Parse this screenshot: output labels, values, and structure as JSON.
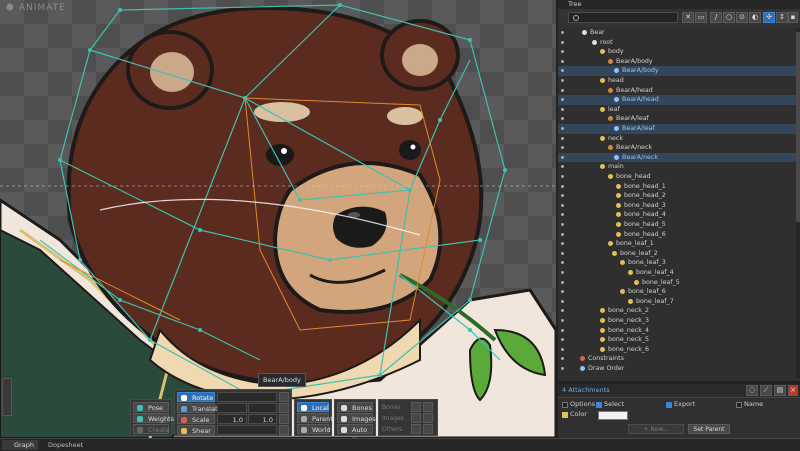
{
  "app": {
    "mode_title": "ANIMATE",
    "tooltip": "BearA/body"
  },
  "colors": {
    "accent": "#2e6fb3",
    "bone_green": "#40c0b0",
    "bone_orange": "#e08a2a",
    "panel_bg": "#2f2f2f"
  },
  "toolbar": {
    "pose": {
      "label": "Pose",
      "icon": "pose-icon"
    },
    "weights": {
      "label": "Weights",
      "icon": "weights-icon"
    },
    "create": {
      "label": "Create",
      "icon": "create-icon"
    },
    "rotate": {
      "label": "Rotate",
      "icon": "rotate-icon"
    },
    "translate": {
      "label": "Translate",
      "icon": "translate-icon"
    },
    "scale": {
      "label": "Scale",
      "x": "1.0",
      "y": "1.0",
      "icon": "scale-icon"
    },
    "shear": {
      "label": "Shear",
      "icon": "shear-icon"
    },
    "local": "Local",
    "parent": "Parent",
    "world": "World",
    "bones": "Bones",
    "images": "Images",
    "auto_key": "Auto Key",
    "sub_bones": "Bones",
    "sub_images": "Images",
    "sub_others": "Others"
  },
  "bottom_tabs": [
    {
      "label": "Graph"
    },
    {
      "label": "Dopesheet"
    }
  ],
  "tree_panel": {
    "title": "Tree",
    "rows": [
      {
        "label": "Bear",
        "icon": "skeleton-icon",
        "color": "#d0d0d0"
      },
      {
        "label": "root",
        "icon": "root-bone-icon",
        "color": "#d0d0d0"
      },
      {
        "label": "body",
        "icon": "bone-icon",
        "color": "#d0d0d0"
      },
      {
        "label": "BearA/body",
        "icon": "slot-icon",
        "color": "#d0d0d0"
      },
      {
        "label": "BearA/body",
        "icon": "image-icon",
        "color": "#8fc3ff"
      },
      {
        "label": "head",
        "icon": "bone-icon",
        "color": "#d0d0d0"
      },
      {
        "label": "BearA/head",
        "icon": "slot-icon",
        "color": "#d0d0d0"
      },
      {
        "label": "BearA/head",
        "icon": "mesh-icon",
        "color": "#8fc3ff"
      },
      {
        "label": "leaf",
        "icon": "bone-icon",
        "color": "#d0d0d0"
      },
      {
        "label": "BearA/leaf",
        "icon": "slot-icon",
        "color": "#d0d0d0"
      },
      {
        "label": "BearA/leaf",
        "icon": "mesh-icon",
        "color": "#8fc3ff"
      },
      {
        "label": "neck",
        "icon": "bone-icon",
        "color": "#d0d0d0"
      },
      {
        "label": "BearA/neck",
        "icon": "slot-icon",
        "color": "#d0d0d0"
      },
      {
        "label": "BearA/neck",
        "icon": "mesh-icon",
        "color": "#8fc3ff"
      },
      {
        "label": "main",
        "icon": "bone-icon",
        "color": "#d0d0d0"
      },
      {
        "label": "bone_head",
        "icon": "bone-icon",
        "color": "#d0d0d0"
      },
      {
        "label": "bone_head_1",
        "icon": "bone-icon",
        "color": "#d0d0d0"
      },
      {
        "label": "bone_head_2",
        "icon": "bone-icon",
        "color": "#d0d0d0"
      },
      {
        "label": "bone_head_3",
        "icon": "bone-icon",
        "color": "#d0d0d0"
      },
      {
        "label": "bone_head_4",
        "icon": "bone-icon",
        "color": "#d0d0d0"
      },
      {
        "label": "bone_head_5",
        "icon": "bone-icon",
        "color": "#d0d0d0"
      },
      {
        "label": "bone_head_6",
        "icon": "bone-icon",
        "color": "#d0d0d0"
      },
      {
        "label": "bone_leaf_1",
        "icon": "bone-icon",
        "color": "#d0d0d0"
      },
      {
        "label": "bone_leaf_2",
        "icon": "bone-icon",
        "color": "#d0d0d0"
      },
      {
        "label": "bone_leaf_3",
        "icon": "bone-icon",
        "color": "#d0d0d0"
      },
      {
        "label": "bone_leaf_4",
        "icon": "bone-icon",
        "color": "#d0d0d0"
      },
      {
        "label": "bone_leaf_5",
        "icon": "bone-icon",
        "color": "#d0d0d0"
      },
      {
        "label": "bone_leaf_6",
        "icon": "bone-icon",
        "color": "#d0d0d0"
      },
      {
        "label": "bone_leaf_7",
        "icon": "bone-icon",
        "color": "#d0d0d0"
      },
      {
        "label": "bone_neck_2",
        "icon": "bone-icon",
        "color": "#d0d0d0"
      },
      {
        "label": "bone_neck_3",
        "icon": "bone-icon",
        "color": "#d0d0d0"
      },
      {
        "label": "bone_neck_4",
        "icon": "bone-icon",
        "color": "#d0d0d0"
      },
      {
        "label": "bone_neck_5",
        "icon": "bone-icon",
        "color": "#d0d0d0"
      },
      {
        "label": "bone_neck_6",
        "icon": "bone-icon",
        "color": "#d0d0d0"
      },
      {
        "label": "Constraints",
        "icon": "constraints-icon",
        "color": "#d0d0d0"
      },
      {
        "label": "Draw Order",
        "icon": "draw-order-icon",
        "color": "#d0d0d0"
      }
    ],
    "attachments_label": "4 Attachments",
    "props": {
      "options": "Options",
      "select": "Select",
      "export": "Export",
      "name": "Name",
      "color": "Color",
      "new_label": "+ New...",
      "set_parent": "Set Parent"
    }
  }
}
